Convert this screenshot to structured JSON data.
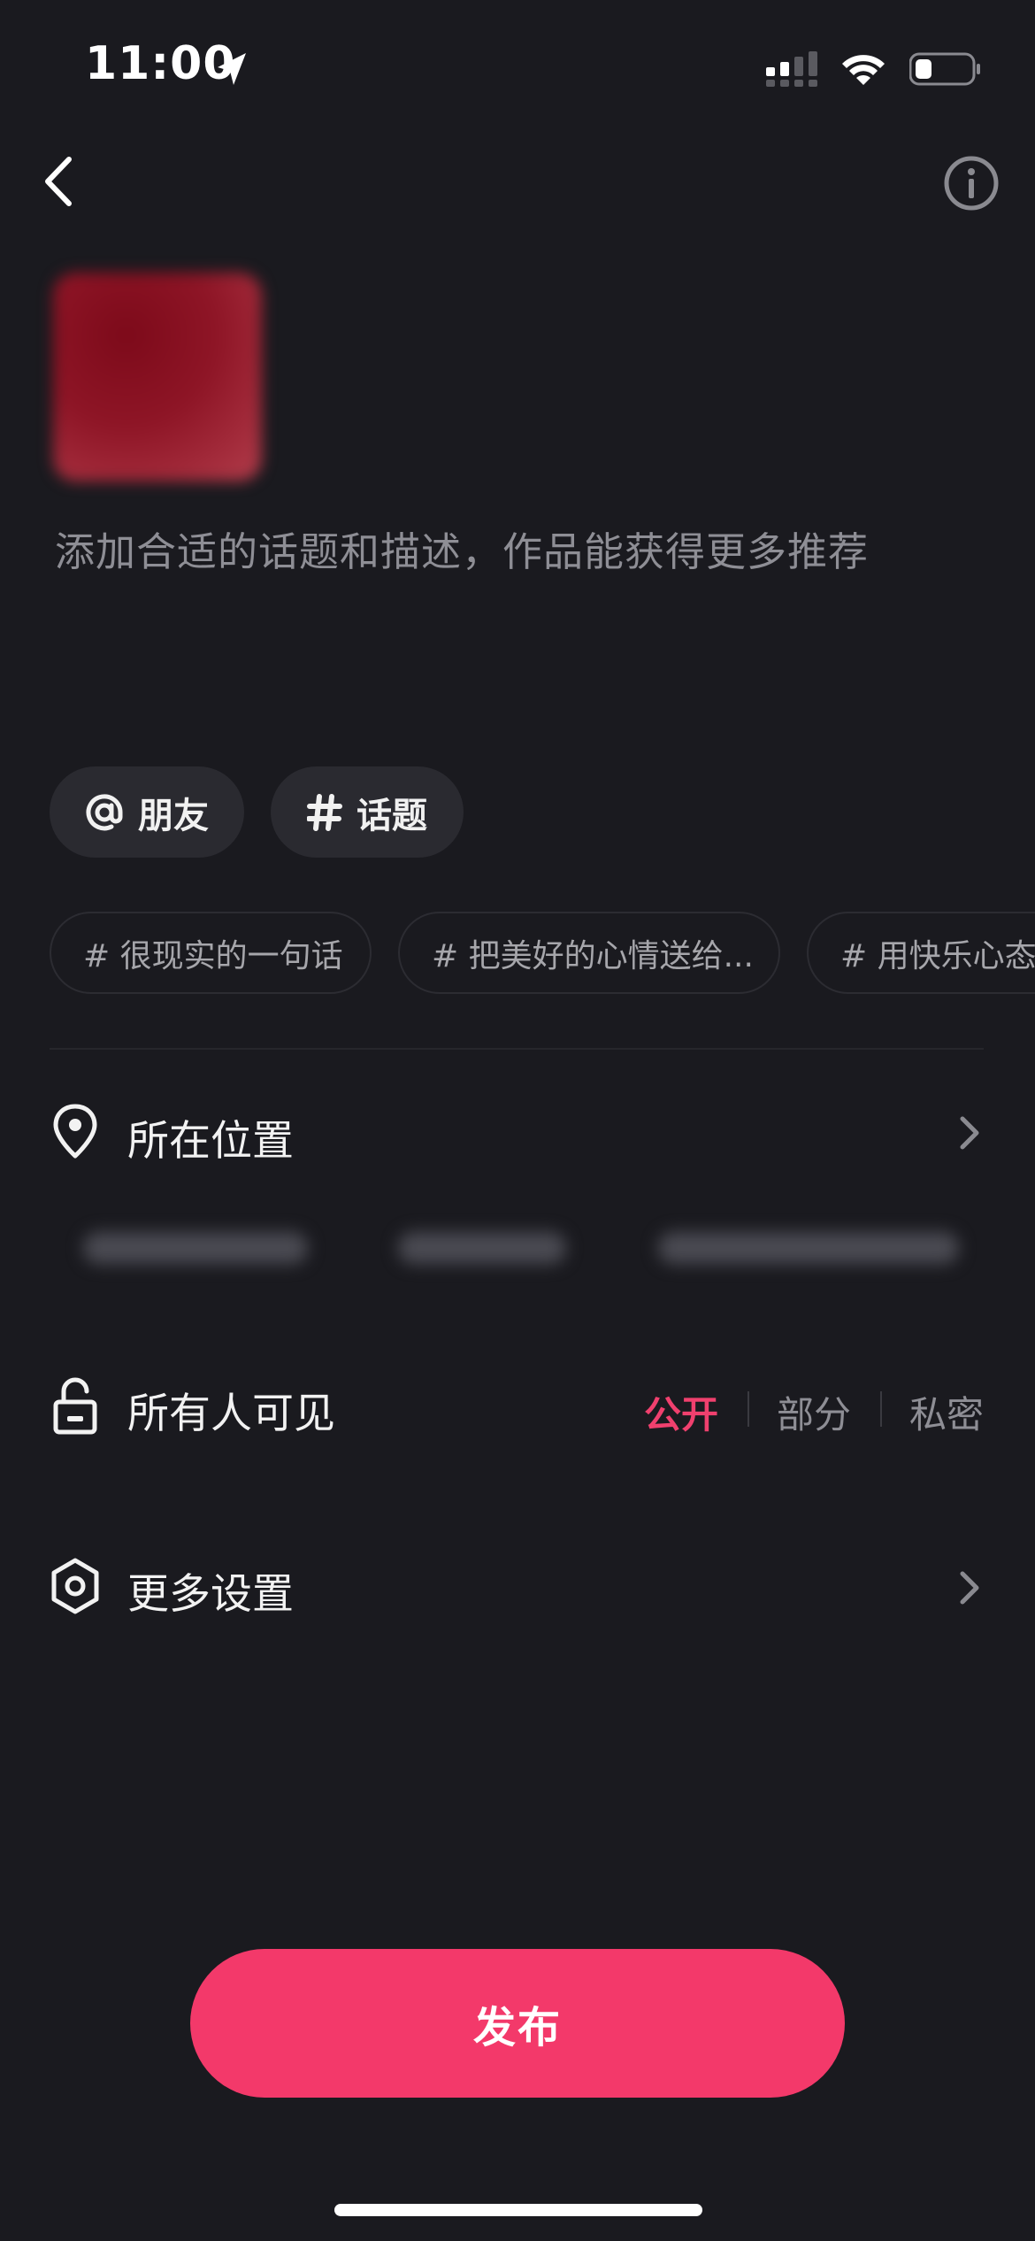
{
  "status_bar": {
    "time": "11:00",
    "icons": [
      "location-arrow-icon",
      "signal-icon",
      "wifi-icon",
      "battery-icon"
    ]
  },
  "nav": {
    "back_icon": "chevron-left-icon",
    "info_icon": "info-icon"
  },
  "description": {
    "placeholder": "添加合适的话题和描述，作品能获得更多推荐"
  },
  "chips": [
    {
      "icon": "at-icon",
      "label": "朋友"
    },
    {
      "icon": "hashtag-icon",
      "label": "话题"
    }
  ],
  "suggested_topics": [
    "# 很现实的一句话",
    "# 把美好的心情送给...",
    "# 用快乐心态接"
  ],
  "location": {
    "icon": "location-pin-icon",
    "label": "所在位置"
  },
  "visibility": {
    "icon": "unlock-icon",
    "label": "所有人可见",
    "options": [
      "公开",
      "部分",
      "私密"
    ],
    "selected": "公开"
  },
  "more_settings": {
    "icon": "hexagon-settings-icon",
    "label": "更多设置"
  },
  "publish": {
    "label": "发布"
  },
  "colors": {
    "background": "#1a1a1f",
    "accent": "#f3396a",
    "selected_option": "#f0406e"
  }
}
